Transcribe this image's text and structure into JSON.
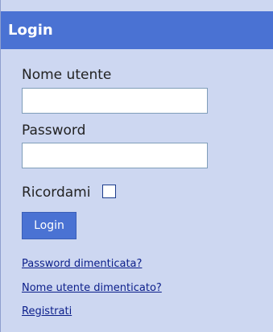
{
  "header": {
    "title": "Login"
  },
  "form": {
    "username_label": "Nome utente",
    "username_value": "",
    "password_label": "Password",
    "password_value": "",
    "remember_label": "Ricordami",
    "remember_checked": false,
    "login_button": "Login"
  },
  "links": {
    "forgot_password": "Password dimenticata?",
    "forgot_username": "Nome utente dimenticato?",
    "register": "Registrati"
  },
  "colors": {
    "header_bg": "#4a72d3",
    "panel_bg": "#cdd7f1",
    "link": "#0b1e8a"
  }
}
